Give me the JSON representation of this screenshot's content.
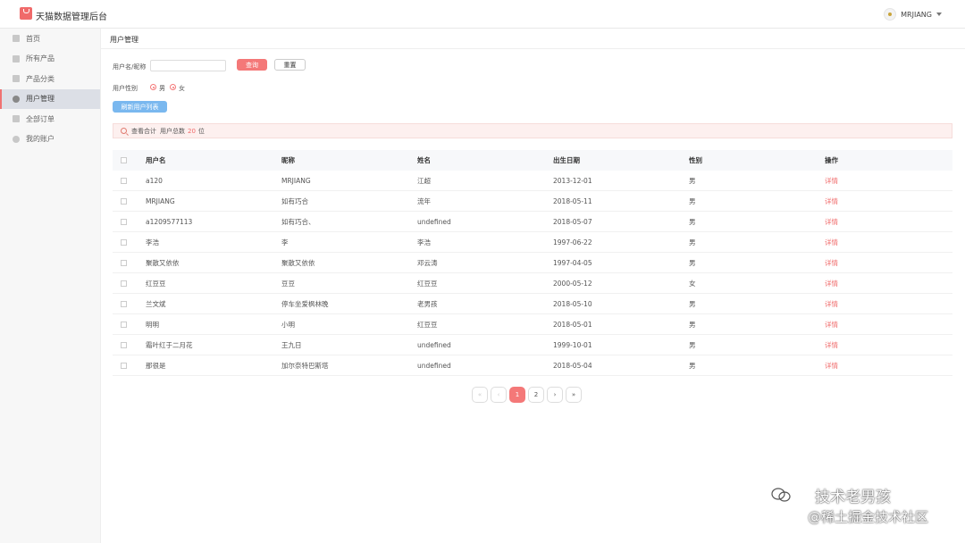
{
  "app": {
    "title": "天猫数据管理后台",
    "user": "MRJIANG"
  },
  "sidebar": {
    "items": [
      {
        "label": "首页",
        "active": false
      },
      {
        "label": "所有产品",
        "active": false
      },
      {
        "label": "产品分类",
        "active": false
      },
      {
        "label": "用户管理",
        "active": true
      },
      {
        "label": "全部订单",
        "active": false
      },
      {
        "label": "我的账户",
        "active": false
      }
    ]
  },
  "page": {
    "title": "用户管理"
  },
  "filters": {
    "name_label": "用户名/昵称",
    "name_value": "",
    "query_button": "查询",
    "reset_button": "重置",
    "gender_label": "用户性别",
    "gender_options": [
      "男",
      "女"
    ],
    "refresh_button": "刷新用户列表"
  },
  "summary": {
    "label": "查看合计",
    "prefix": "用户总数",
    "count": "20",
    "unit": "位"
  },
  "table": {
    "columns": [
      "用户名",
      "昵称",
      "姓名",
      "出生日期",
      "性别",
      "操作"
    ],
    "rows": [
      {
        "username": "a120",
        "nickname": "MRJIANG",
        "name": "江超",
        "birthday": "2013-12-01",
        "gender": "男",
        "action": "详情"
      },
      {
        "username": "MRJIANG",
        "nickname": "如有巧合",
        "name": "流年",
        "birthday": "2018-05-11",
        "gender": "男",
        "action": "详情"
      },
      {
        "username": "a1209577113",
        "nickname": "如有巧合、",
        "name": "undefined",
        "birthday": "2018-05-07",
        "gender": "男",
        "action": "详情"
      },
      {
        "username": "李浩",
        "nickname": "李",
        "name": "李浩",
        "birthday": "1997-06-22",
        "gender": "男",
        "action": "详情"
      },
      {
        "username": "聚散又依依",
        "nickname": "聚散又依依",
        "name": "邓云涛",
        "birthday": "1997-04-05",
        "gender": "男",
        "action": "详情"
      },
      {
        "username": "红豆豆",
        "nickname": "豆豆",
        "name": "红豆豆",
        "birthday": "2000-05-12",
        "gender": "女",
        "action": "详情"
      },
      {
        "username": "兰文斌",
        "nickname": "停车坐爱枫林晚",
        "name": "老男孩",
        "birthday": "2018-05-10",
        "gender": "男",
        "action": "详情"
      },
      {
        "username": "明明",
        "nickname": "小明",
        "name": "红豆豆",
        "birthday": "2018-05-01",
        "gender": "男",
        "action": "详情"
      },
      {
        "username": "霜叶红于二月花",
        "nickname": "王九日",
        "name": "undefined",
        "birthday": "1999-10-01",
        "gender": "男",
        "action": "详情"
      },
      {
        "username": "那很是",
        "nickname": "加尔奈特巴斯塔",
        "name": "undefined",
        "birthday": "2018-05-04",
        "gender": "男",
        "action": "详情"
      }
    ]
  },
  "pagination": {
    "first": "«",
    "prev": "‹",
    "pages": [
      "1",
      "2"
    ],
    "current": "1",
    "next": "›",
    "last": "»"
  },
  "watermark": {
    "line1": "技术老男孩",
    "line2": "@稀土掘金技术社区"
  }
}
